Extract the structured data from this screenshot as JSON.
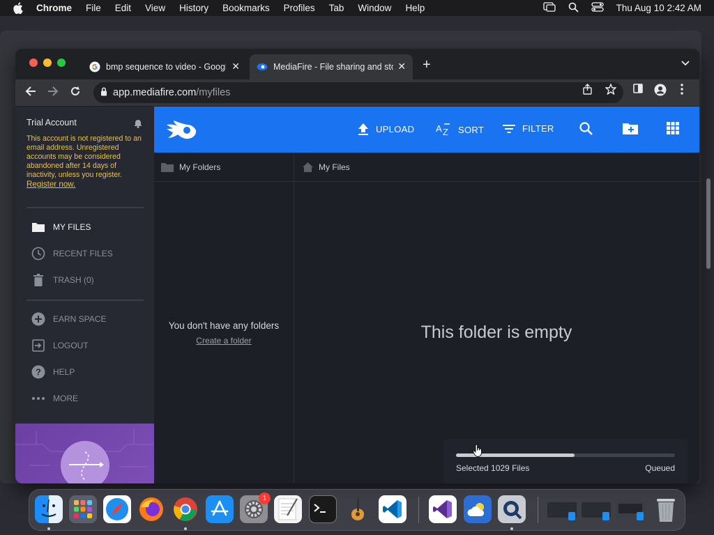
{
  "menubar": {
    "app": "Chrome",
    "items": [
      "File",
      "Edit",
      "View",
      "History",
      "Bookmarks",
      "Profiles",
      "Tab",
      "Window",
      "Help"
    ],
    "clock": "Thu Aug 10  2:42 AM"
  },
  "tabs": [
    {
      "title": "bmp sequence to video - Google Search"
    },
    {
      "title": "MediaFire - File sharing and storage"
    }
  ],
  "omnibox": {
    "host": "app.mediafire.com",
    "path": "/myfiles"
  },
  "sidebar": {
    "account": "Trial Account",
    "warning": "This account is not registered to an email address. Unregistered accounts may be considered abandoned after 14 days of inactivity, unless you register.",
    "register_link": "Register now.",
    "nav": [
      {
        "label": "MY FILES",
        "icon": "folder-icon"
      },
      {
        "label": "RECENT FILES",
        "icon": "clock-icon"
      },
      {
        "label": "TRASH (0)",
        "icon": "trash-icon"
      }
    ],
    "nav2": [
      {
        "label": "EARN SPACE",
        "icon": "plus-circle-icon"
      },
      {
        "label": "LOGOUT",
        "icon": "logout-icon"
      },
      {
        "label": "HELP",
        "icon": "help-icon"
      },
      {
        "label": "MORE",
        "icon": "more-icon"
      }
    ]
  },
  "topbar": {
    "upload": "UPLOAD",
    "sort": "SORT",
    "filter": "FILTER"
  },
  "folders": {
    "header": "My Folders",
    "empty": "You don't have any folders",
    "create": "Create a folder"
  },
  "files": {
    "header": "My Files",
    "empty": "This folder is empty"
  },
  "upload_status": {
    "text": "Selected 1029 Files",
    "state": "Queued",
    "progress_fraction": 0.54
  },
  "colors": {
    "brand_blue": "#1a73f0",
    "warning_yellow": "#e9c04a",
    "promo_purple": "#7d4fb5"
  },
  "dock": {
    "settings_badge": "1"
  }
}
